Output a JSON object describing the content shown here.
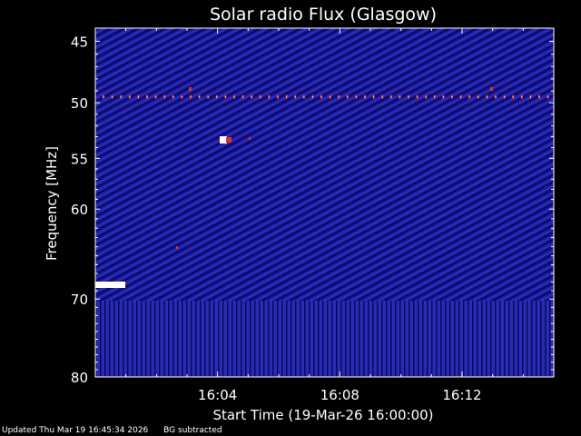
{
  "footer": {
    "updated": "Updated Thu Mar 19 16:45:34 2026",
    "note": "BG subtracted"
  },
  "chart_data": {
    "type": "heatmap",
    "title": "Solar radio Flux (Glasgow)",
    "xlabel": "Start Time (19-Mar-26 16:00:00)",
    "ylabel": "Frequency [MHz]",
    "x_ticks": [
      "16:04",
      "16:08",
      "16:12"
    ],
    "y_ticks": [
      "45",
      "50",
      "55",
      "60",
      "70",
      "80"
    ],
    "y_tick_values": [
      45,
      50,
      55,
      60,
      70,
      80
    ],
    "yscale": "log",
    "ylim": [
      44,
      80
    ],
    "xlim": [
      "16:00:00",
      "16:15:00"
    ],
    "colors": {
      "background": "#000000",
      "spectrum_base": "#1a1aa6",
      "stripe_dark": "#0a0a55",
      "stripe_light": "#3a3ad2",
      "lower_band": "#2a2ab8",
      "red_dots": "#e03020",
      "hot": "#ffffff"
    }
  }
}
